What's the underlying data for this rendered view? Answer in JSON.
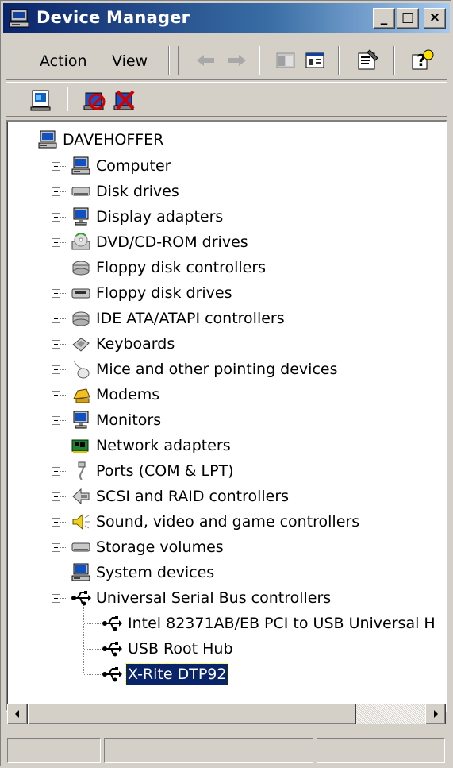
{
  "window": {
    "title": "Device Manager",
    "title_icon": "computer-manager-icon",
    "controls": {
      "minimize": "_",
      "maximize": "□",
      "close": "×"
    }
  },
  "menubar": {
    "items": [
      "Action",
      "View"
    ]
  },
  "toolbar": {
    "icons": [
      "back-arrow-icon",
      "forward-arrow-icon",
      "show-hide-console-tree-icon",
      "export-list-icon",
      "properties-icon",
      "help-icon"
    ]
  },
  "action_toolbar": {
    "icons": [
      "scan-hardware-changes-icon",
      "disable-device-icon",
      "uninstall-device-icon"
    ]
  },
  "tree": {
    "root": {
      "label": "DAVEHOFFER",
      "icon": "computer-icon",
      "expanded": true
    },
    "categories": [
      {
        "label": "Computer",
        "icon": "computer-icon"
      },
      {
        "label": "Disk drives",
        "icon": "disk-drive-icon"
      },
      {
        "label": "Display adapters",
        "icon": "display-adapter-icon"
      },
      {
        "label": "DVD/CD-ROM drives",
        "icon": "cd-rom-icon"
      },
      {
        "label": "Floppy disk controllers",
        "icon": "controller-icon"
      },
      {
        "label": "Floppy disk drives",
        "icon": "floppy-drive-icon"
      },
      {
        "label": "IDE ATA/ATAPI controllers",
        "icon": "controller-icon"
      },
      {
        "label": "Keyboards",
        "icon": "keyboard-icon"
      },
      {
        "label": "Mice and other pointing devices",
        "icon": "mouse-icon"
      },
      {
        "label": "Modems",
        "icon": "modem-icon"
      },
      {
        "label": "Monitors",
        "icon": "monitor-icon"
      },
      {
        "label": "Network adapters",
        "icon": "network-adapter-icon"
      },
      {
        "label": "Ports (COM & LPT)",
        "icon": "port-icon"
      },
      {
        "label": "SCSI and RAID controllers",
        "icon": "scsi-icon"
      },
      {
        "label": "Sound, video and game controllers",
        "icon": "sound-icon"
      },
      {
        "label": "Storage volumes",
        "icon": "disk-drive-icon"
      },
      {
        "label": "System devices",
        "icon": "computer-icon"
      },
      {
        "label": "Universal Serial Bus controllers",
        "icon": "usb-icon",
        "expanded": true
      }
    ],
    "usb_children": [
      {
        "label": "Intel 82371AB/EB PCI to USB Universal H",
        "icon": "usb-icon"
      },
      {
        "label": "USB Root Hub",
        "icon": "usb-icon"
      },
      {
        "label": "X-Rite DTP92",
        "icon": "usb-icon",
        "selected": true
      }
    ]
  },
  "colors": {
    "title_gradient_start": "#0a246a",
    "title_gradient_end": "#a6caf0",
    "selection": "#0a246a",
    "face": "#d4d0c8"
  },
  "statusbar": {
    "panes": [
      "",
      "",
      ""
    ]
  }
}
